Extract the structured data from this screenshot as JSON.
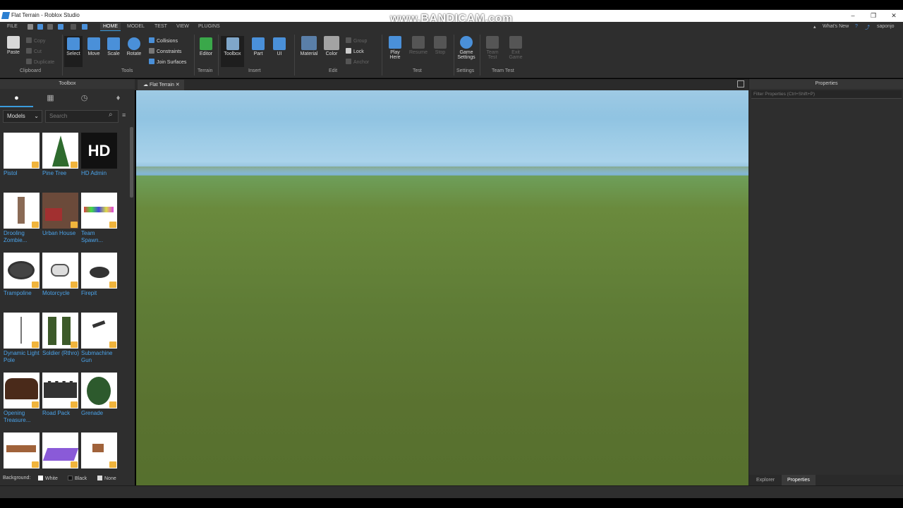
{
  "window": {
    "title": "Flat Terrain - Roblox Studio"
  },
  "watermark": "www.BANDICAM.com",
  "menu": {
    "items": [
      "FILE",
      "HOME",
      "MODEL",
      "TEST",
      "VIEW",
      "PLUGINS"
    ],
    "active": "HOME",
    "whats_new": "What's New",
    "user": "saponjo"
  },
  "ribbon": {
    "clipboard": {
      "paste": "Paste",
      "copy": "Copy",
      "cut": "Cut",
      "duplicate": "Duplicate",
      "label": "Clipboard"
    },
    "tools": {
      "select": "Select",
      "move": "Move",
      "scale": "Scale",
      "rotate": "Rotate",
      "collisions": "Collisions",
      "constraints": "Constraints",
      "join_surfaces": "Join Surfaces",
      "label": "Tools"
    },
    "terrain": {
      "editor": "Editor",
      "label": "Terrain"
    },
    "insert": {
      "toolbox": "Toolbox",
      "part": "Part",
      "ui": "UI",
      "label": "Insert"
    },
    "edit": {
      "material": "Material",
      "color": "Color",
      "group": "Group",
      "lock": "Lock",
      "anchor": "Anchor",
      "label": "Edit"
    },
    "test": {
      "play": "Play",
      "play_here": "Here",
      "resume": "Resume",
      "stop": "Stop",
      "label": "Test"
    },
    "settings": {
      "game": "Game",
      "game2": "Settings",
      "label": "Settings"
    },
    "teamtest": {
      "team": "Team",
      "team2": "Test",
      "exit": "Exit",
      "exit2": "Game",
      "label": "Team Test"
    }
  },
  "toolbox": {
    "title": "Toolbox",
    "filter": "Models",
    "search_placeholder": "Search",
    "items": [
      {
        "name": "Pistol"
      },
      {
        "name": "Pine Tree"
      },
      {
        "name": "HD Admin"
      },
      {
        "name": "Drooling Zombie..."
      },
      {
        "name": "Urban House"
      },
      {
        "name": "Team Spawn..."
      },
      {
        "name": "Trampoline"
      },
      {
        "name": "Motorcycle"
      },
      {
        "name": "Firepit"
      },
      {
        "name": "Dynamic Light Pole"
      },
      {
        "name": "Soldier (Rthro)"
      },
      {
        "name": "Submachine Gun"
      },
      {
        "name": "Opening Treasure..."
      },
      {
        "name": "Road Pack"
      },
      {
        "name": "Grenade"
      },
      {
        "name": ""
      },
      {
        "name": ""
      },
      {
        "name": ""
      }
    ],
    "background_label": "Background:",
    "bg_white": "White",
    "bg_black": "Black",
    "bg_none": "None"
  },
  "document": {
    "tab": "Flat Terrain"
  },
  "properties": {
    "title": "Properties",
    "filter_placeholder": "Filter Properties (Ctrl+Shift+P)",
    "tab_explorer": "Explorer",
    "tab_properties": "Properties"
  }
}
